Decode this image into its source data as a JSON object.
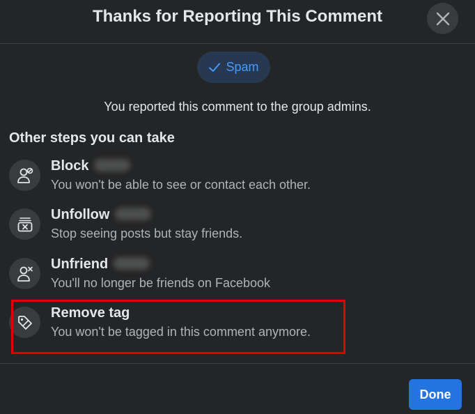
{
  "dialog": {
    "title": "Thanks for Reporting This Comment",
    "reported_category": "Spam",
    "reported_message": "You reported this comment to the group admins.",
    "section_title": "Other steps you can take",
    "done_label": "Done"
  },
  "options": [
    {
      "title": "Block",
      "subtitle": "You won't be able to see or contact each other.",
      "icon": "block-user-icon"
    },
    {
      "title": "Unfollow",
      "subtitle": "Stop seeing posts but stay friends.",
      "icon": "unfollow-icon"
    },
    {
      "title": "Unfriend",
      "subtitle": "You'll no longer be friends on Facebook",
      "icon": "unfriend-icon"
    },
    {
      "title": "Remove tag",
      "subtitle": "You won't be tagged in this comment anymore.",
      "icon": "tag-icon"
    }
  ],
  "colors": {
    "background": "#242526",
    "accent": "#2374e1",
    "pill_background": "#263951",
    "pill_text": "#4599ff",
    "highlight_border": "#e00000"
  }
}
